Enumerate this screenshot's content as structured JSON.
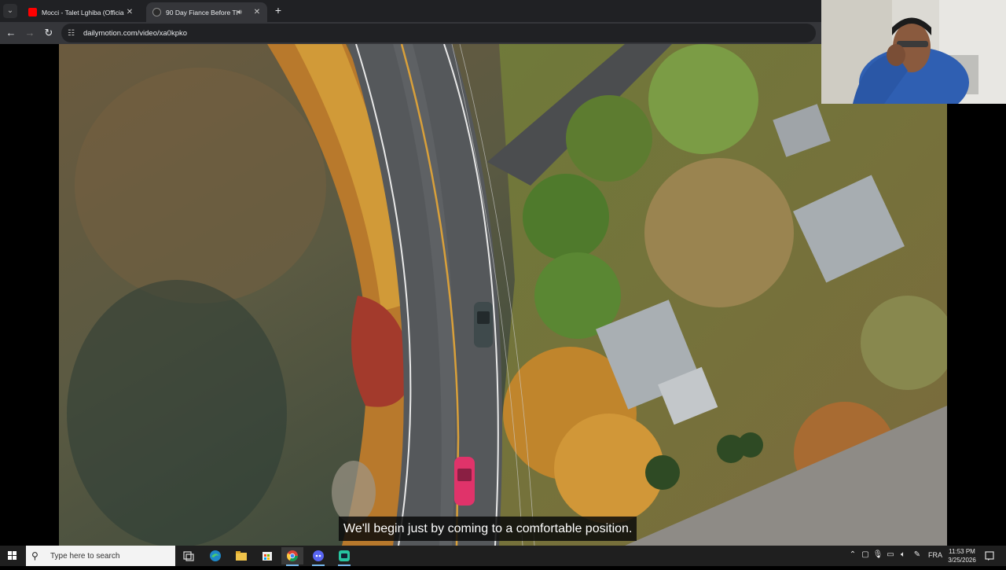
{
  "browser": {
    "tab_dropdown_icon": "chevron-down-icon",
    "tabs": [
      {
        "label": "Mocci - Talet Lghiba (Official Ly",
        "favicon": "youtube-icon",
        "favicon_color": "#ff0000"
      },
      {
        "label": "90 Day Fiance Before The 9",
        "favicon": "dailymotion-icon",
        "favicon_color": "#7a7a7a",
        "sound": "speaker-icon"
      }
    ],
    "new_tab_label": "+",
    "url": "dailymotion.com/video/xa0kpko"
  },
  "video": {
    "subtitle": "We'll begin just by coming to a comfortable position."
  },
  "taskbar": {
    "search_placeholder": "Type here to search",
    "apps": [
      "task-view-icon",
      "edge-icon",
      "file-explorer-icon",
      "store-icon",
      "chrome-icon",
      "discord-icon",
      "app-icon"
    ],
    "language": "FRA",
    "time": "11:53 PM",
    "date": "3/25/2026"
  },
  "colors": {
    "chrome_dark": "#202124",
    "chrome_toolbar": "#35363a",
    "taskbar": "#1f1f1f",
    "accent": "#76b9ed"
  }
}
